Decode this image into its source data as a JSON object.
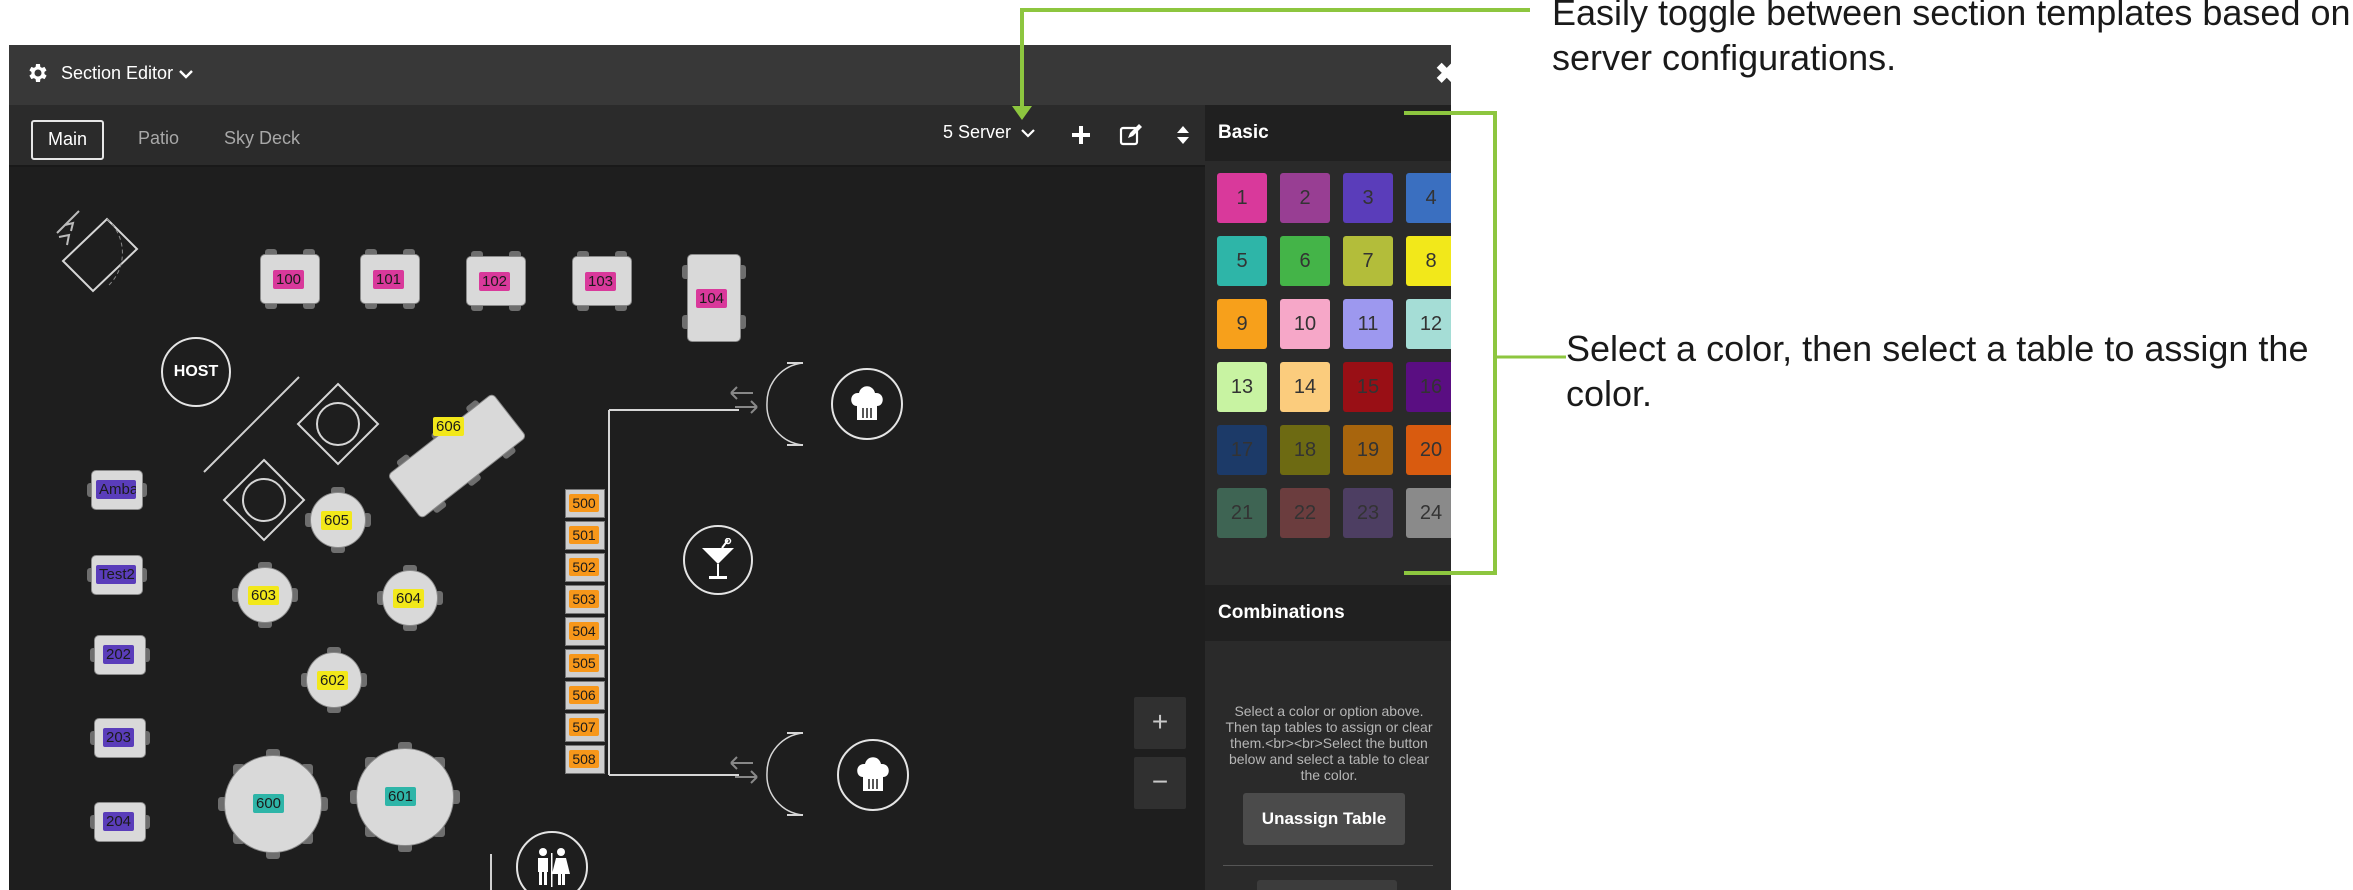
{
  "window": {
    "title": "Section Editor"
  },
  "tabs": [
    {
      "label": "Main",
      "active": true
    },
    {
      "label": "Patio",
      "active": false
    },
    {
      "label": "Sky Deck",
      "active": false
    }
  ],
  "server_select": {
    "value": "5 Server"
  },
  "floor": {
    "host_label": "HOST",
    "tables_top": [
      "100",
      "101",
      "102",
      "103",
      "104"
    ],
    "tables_left": [
      "Amba",
      "Test2",
      "202",
      "203",
      "204"
    ],
    "tables_round": [
      "605",
      "603",
      "604",
      "602"
    ],
    "table_606": "606",
    "tables_large": [
      "600",
      "601"
    ],
    "bar_seats": [
      "500",
      "501",
      "502",
      "503",
      "504",
      "505",
      "506",
      "507",
      "508"
    ]
  },
  "zoom": {
    "in": "+",
    "out": "−"
  },
  "panel": {
    "basic_heading": "Basic",
    "colors": [
      {
        "n": "1",
        "c": "#d9399b"
      },
      {
        "n": "2",
        "c": "#983e93"
      },
      {
        "n": "3",
        "c": "#5a3dba"
      },
      {
        "n": "4",
        "c": "#3a6fc0"
      },
      {
        "n": "5",
        "c": "#2eb5a8"
      },
      {
        "n": "6",
        "c": "#44b448"
      },
      {
        "n": "7",
        "c": "#b3bd3a"
      },
      {
        "n": "8",
        "c": "#f2e81a"
      },
      {
        "n": "9",
        "c": "#f7a01b"
      },
      {
        "n": "10",
        "c": "#f6a7c8"
      },
      {
        "n": "11",
        "c": "#9d98ef"
      },
      {
        "n": "12",
        "c": "#a5ddd6"
      },
      {
        "n": "13",
        "c": "#c8f3a2"
      },
      {
        "n": "14",
        "c": "#fbcc7d"
      },
      {
        "n": "15",
        "c": "#990f15"
      },
      {
        "n": "16",
        "c": "#5a0e82"
      },
      {
        "n": "17",
        "c": "#1c3a68"
      },
      {
        "n": "18",
        "c": "#6d6a12"
      },
      {
        "n": "19",
        "c": "#a8650d"
      },
      {
        "n": "20",
        "c": "#d95b0f"
      },
      {
        "n": "21",
        "c": "#3e6453"
      },
      {
        "n": "22",
        "c": "#6b3d3e"
      },
      {
        "n": "23",
        "c": "#4d3e62"
      },
      {
        "n": "24",
        "c": "#8a8a8a"
      }
    ],
    "combinations_heading": "Combinations",
    "help_text": "Select a color or option above. Then tap tables to assign or clear them.<br><br>Select the button below and select a table to clear the color.",
    "unassign_label": "Unassign Table"
  },
  "callouts": {
    "top": "Easily toggle between section templates based on server configurations.",
    "right": "Select a color, then select a table to assign the color."
  },
  "accent": "#8dc63f"
}
